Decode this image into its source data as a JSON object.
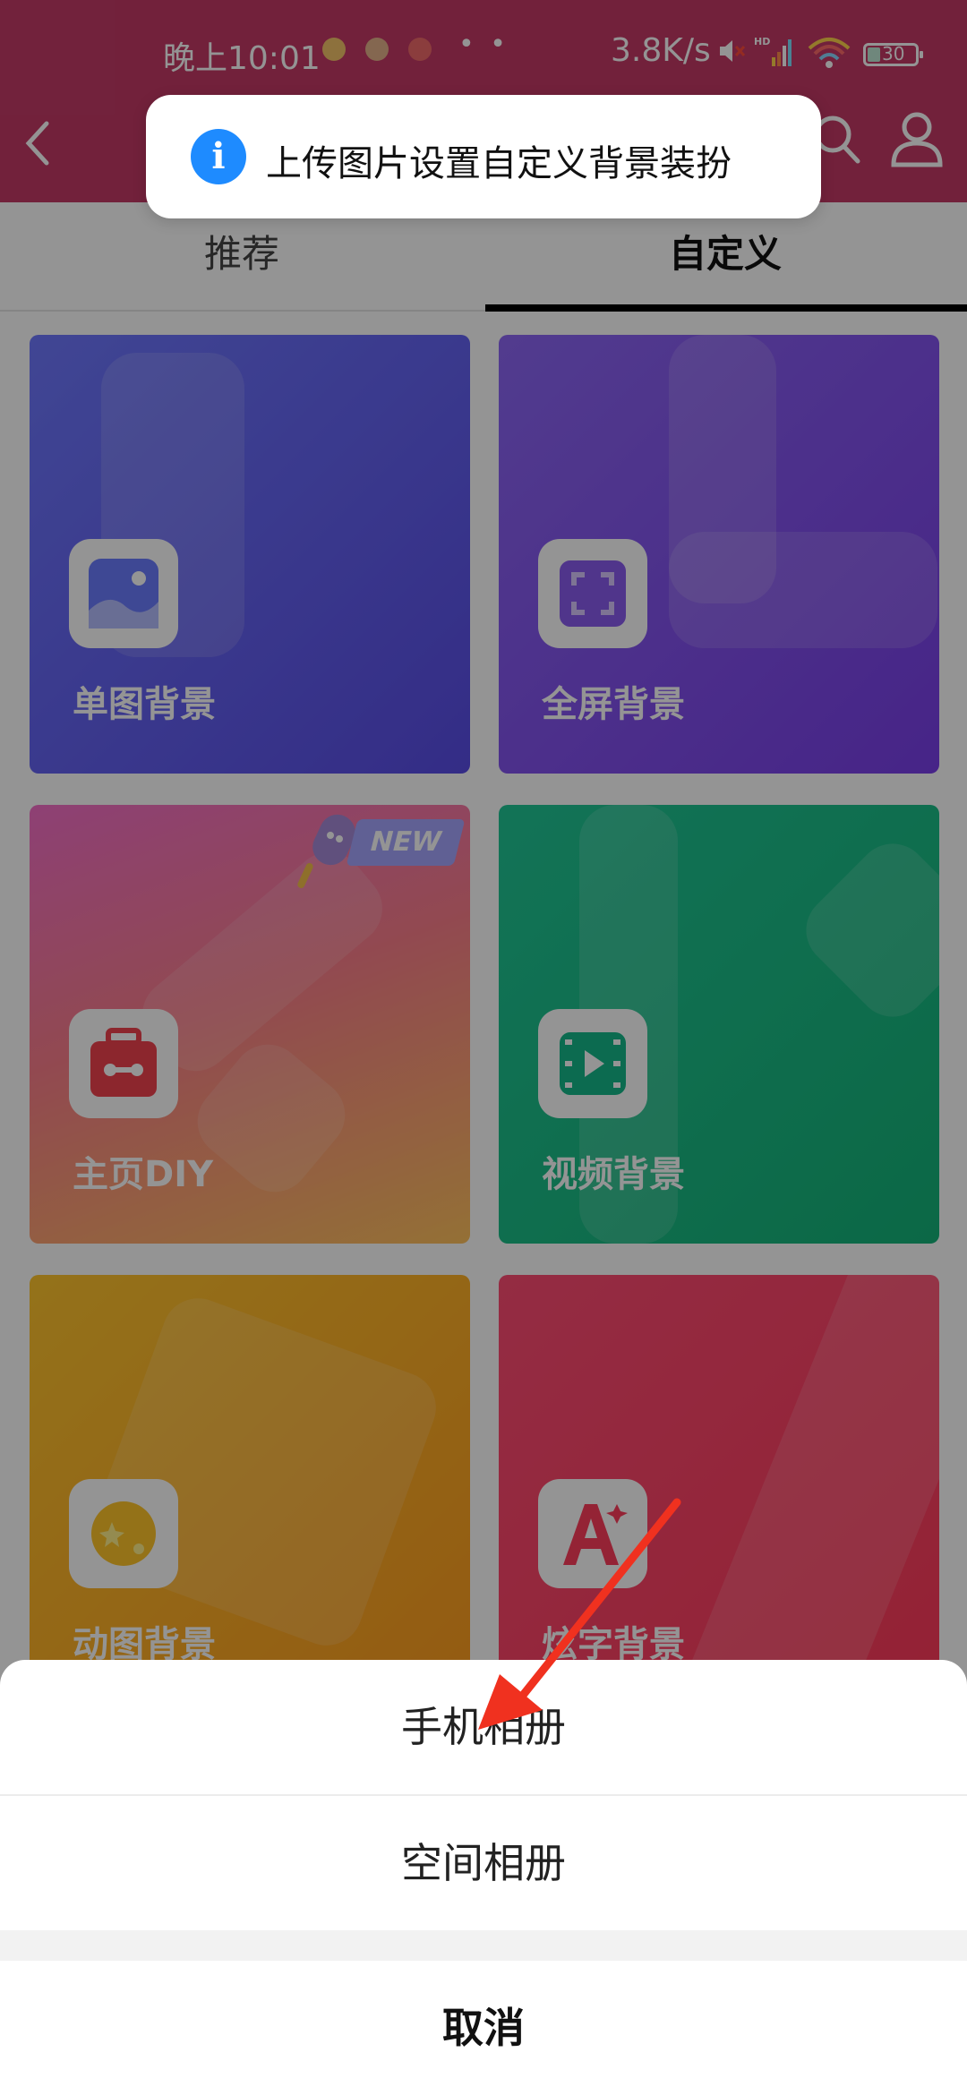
{
  "status_bar": {
    "time": "晚上10:01",
    "dots": "• •",
    "network_speed": "3.8K/s",
    "battery_level": "30"
  },
  "header": {
    "back_icon": "chevron-left-icon",
    "search_icon": "search-icon",
    "user_icon": "user-icon",
    "color": "#c53a67"
  },
  "tabs": {
    "recommended": "推荐",
    "custom": "自定义"
  },
  "grid": {
    "items": [
      {
        "label": "单图背景",
        "icon": "image-icon"
      },
      {
        "label": "全屏背景",
        "icon": "fullscreen-icon"
      },
      {
        "label": "主页DIY",
        "icon": "toolbox-icon",
        "badge": "NEW"
      },
      {
        "label": "视频背景",
        "icon": "video-icon"
      },
      {
        "label": "动图背景",
        "icon": "animated-icon"
      },
      {
        "label": "炫字背景",
        "icon": "fancy-text-icon"
      }
    ]
  },
  "toast": {
    "icon": "info-icon",
    "message": "上传图片设置自定义背景装扮"
  },
  "sheet": {
    "option_phone_album": "手机相册",
    "option_space_album": "空间相册",
    "cancel": "取消"
  },
  "colors": {
    "accent": "#c53a67",
    "info_blue": "#1e8bff",
    "arrow_red": "#f0311f"
  }
}
